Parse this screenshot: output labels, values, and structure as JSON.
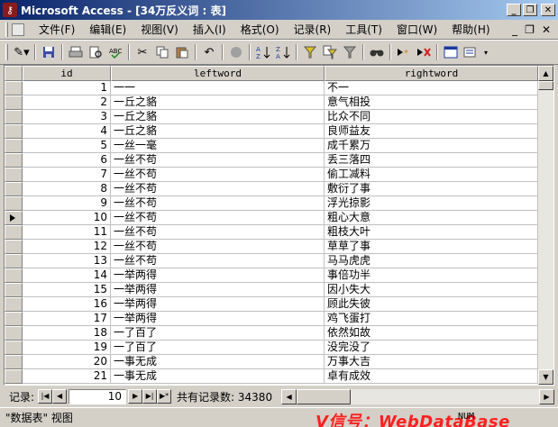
{
  "window": {
    "title": "Microsoft Access - [34万反义词 : 表]",
    "min_glyph": "_",
    "restore_glyph": "❐",
    "close_glyph": "✕"
  },
  "menu": {
    "items": [
      "文件(F)",
      "编辑(E)",
      "视图(V)",
      "插入(I)",
      "格式(O)",
      "记录(R)",
      "工具(T)",
      "窗口(W)",
      "帮助(H)"
    ],
    "mdi_min": "_",
    "mdi_restore": "❐",
    "mdi_close": "✕"
  },
  "toolbar": {
    "icons": [
      "design-view-icon",
      "save-icon",
      "print-icon",
      "print-preview-icon",
      "spelling-icon",
      "cut-icon",
      "copy-icon",
      "paste-icon",
      "undo-icon",
      "hyperlink-icon",
      "sort-ascending-icon",
      "sort-descending-icon",
      "filter-by-selection-icon",
      "filter-by-form-icon",
      "apply-filter-icon",
      "find-icon",
      "new-record-icon",
      "delete-record-icon",
      "database-window-icon",
      "new-object-icon"
    ]
  },
  "table": {
    "columns": [
      "id",
      "leftword",
      "rightword"
    ],
    "current_row_index": 9,
    "rows": [
      {
        "id": "1",
        "leftword": "一一",
        "rightword": "不一"
      },
      {
        "id": "2",
        "leftword": "一丘之貉",
        "rightword": "意气相投"
      },
      {
        "id": "3",
        "leftword": "一丘之貉",
        "rightword": "比众不同"
      },
      {
        "id": "4",
        "leftword": "一丘之貉",
        "rightword": "良师益友"
      },
      {
        "id": "5",
        "leftword": "一丝一毫",
        "rightword": "成千累万"
      },
      {
        "id": "6",
        "leftword": "一丝不苟",
        "rightword": "丢三落四"
      },
      {
        "id": "7",
        "leftword": "一丝不苟",
        "rightword": "偷工减料"
      },
      {
        "id": "8",
        "leftword": "一丝不苟",
        "rightword": "敷衍了事"
      },
      {
        "id": "9",
        "leftword": "一丝不苟",
        "rightword": "浮光掠影"
      },
      {
        "id": "10",
        "leftword": "一丝不苟",
        "rightword": "粗心大意"
      },
      {
        "id": "11",
        "leftword": "一丝不苟",
        "rightword": "粗枝大叶"
      },
      {
        "id": "12",
        "leftword": "一丝不苟",
        "rightword": "草草了事"
      },
      {
        "id": "13",
        "leftword": "一丝不苟",
        "rightword": "马马虎虎"
      },
      {
        "id": "14",
        "leftword": "一举两得",
        "rightword": "事倍功半"
      },
      {
        "id": "15",
        "leftword": "一举两得",
        "rightword": "因小失大"
      },
      {
        "id": "16",
        "leftword": "一举两得",
        "rightword": "顾此失彼"
      },
      {
        "id": "17",
        "leftword": "一举两得",
        "rightword": "鸡飞蛋打"
      },
      {
        "id": "18",
        "leftword": "一了百了",
        "rightword": "依然如故"
      },
      {
        "id": "19",
        "leftword": "一了百了",
        "rightword": "没完没了"
      },
      {
        "id": "20",
        "leftword": "一事无成",
        "rightword": "万事大吉"
      },
      {
        "id": "21",
        "leftword": "一事无成",
        "rightword": "卓有成效"
      }
    ]
  },
  "navigation": {
    "label": "记录:",
    "first": "|◀",
    "prev": "◀",
    "current_record": "10",
    "next": "▶",
    "last": "▶|",
    "new": "▶*",
    "total": "共有记录数: 34380"
  },
  "status": {
    "text": "\"数据表\" 视图",
    "watermark": "V信号：WebDataBase",
    "num_indicator": "NUM"
  }
}
